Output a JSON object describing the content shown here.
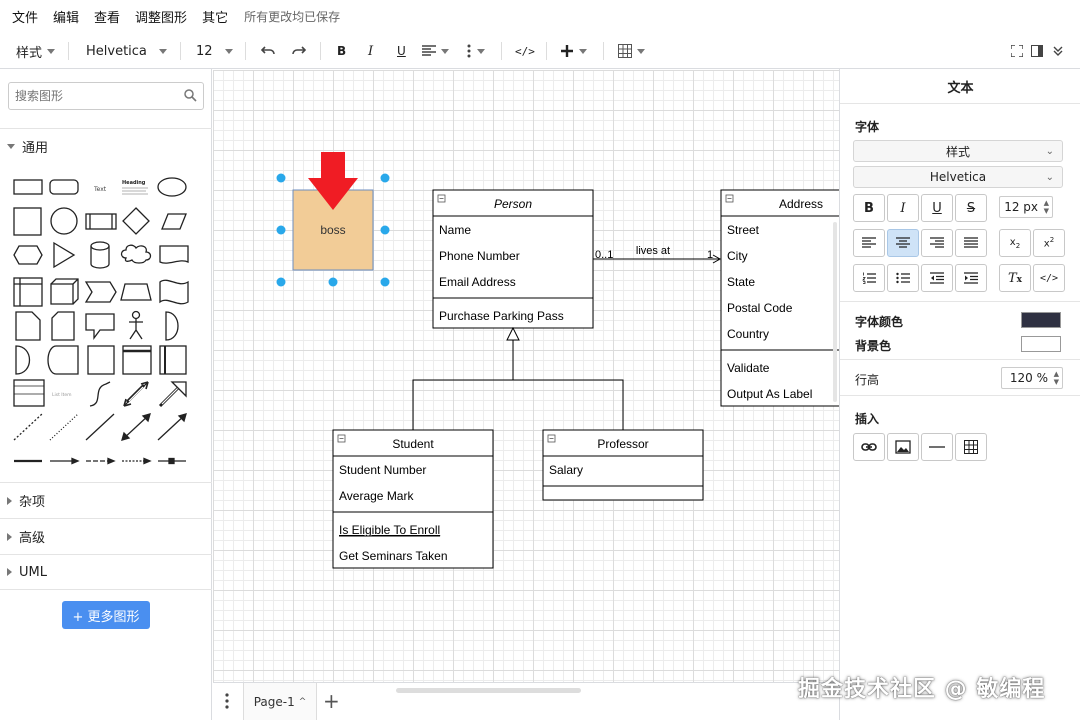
{
  "menu": {
    "items": [
      "文件",
      "编辑",
      "查看",
      "调整图形",
      "其它"
    ],
    "status": "所有更改均已保存"
  },
  "toolbar": {
    "style_label": "样式",
    "font_family": "Helvetica",
    "font_size": "12"
  },
  "sidebar": {
    "search_placeholder": "搜索图形",
    "sections": {
      "general": "通用",
      "misc": "杂项",
      "advanced": "高级",
      "uml": "UML"
    },
    "more_shapes": "+ 更多图形"
  },
  "diagram": {
    "boss_label": "boss",
    "person": {
      "title": "Person",
      "attrs": [
        "Name",
        "Phone Number",
        "Email Address"
      ],
      "methods": [
        "Purchase Parking Pass"
      ]
    },
    "address": {
      "title": "Address",
      "attrs": [
        "Street",
        "City",
        "State",
        "Postal Code",
        "Country"
      ],
      "methods": [
        "Validate",
        "Output As Label"
      ]
    },
    "student": {
      "title": "Student",
      "attrs": [
        "Student Number",
        "Average Mark"
      ],
      "methods": [
        "Is Eligible To Enroll",
        "Get Seminars Taken"
      ]
    },
    "professor": {
      "title": "Professor",
      "attrs": [
        "Salary"
      ]
    },
    "association": {
      "label": "lives at",
      "mult_left": "0..1",
      "mult_right": "1"
    }
  },
  "pagebar": {
    "page_tab": "Page-1"
  },
  "panel": {
    "title": "文本",
    "font_section": "字体",
    "style_select": "样式",
    "font_select": "Helvetica",
    "font_size": "12 px",
    "font_color_label": "字体颜色",
    "bg_color_label": "背景色",
    "line_height_label": "行高",
    "line_height": "120 %",
    "insert_label": "插入",
    "font_color": "#2f3142",
    "bg_color": "#ffffff"
  },
  "watermark": "掘金技术社区 @ 敏编程"
}
